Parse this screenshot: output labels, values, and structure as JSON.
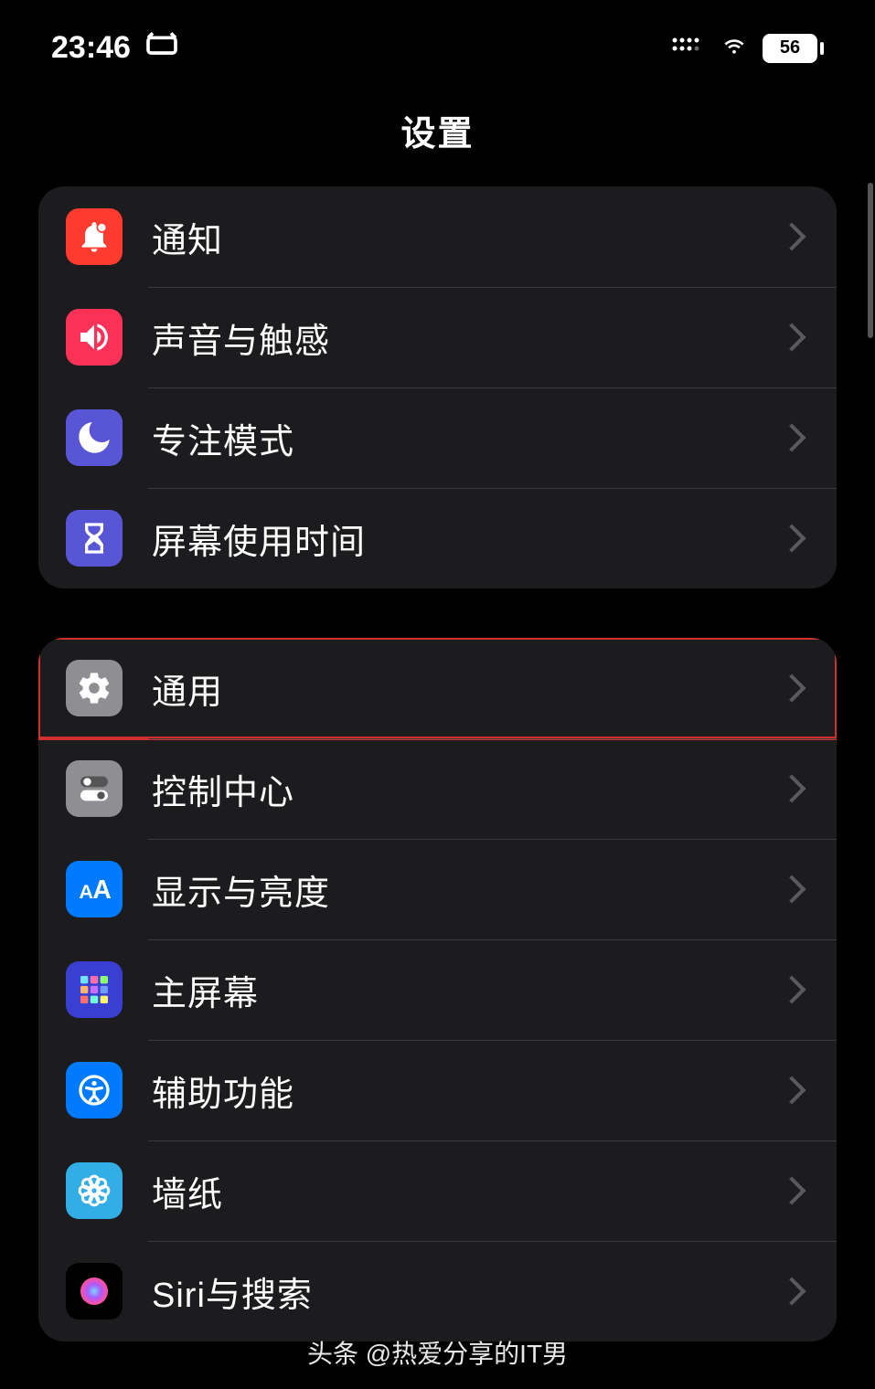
{
  "status": {
    "time": "23:46",
    "battery_text": "56"
  },
  "title": "设置",
  "group1": {
    "items": [
      {
        "label": "通知"
      },
      {
        "label": "声音与触感"
      },
      {
        "label": "专注模式"
      },
      {
        "label": "屏幕使用时间"
      }
    ]
  },
  "group2": {
    "items": [
      {
        "label": "通用"
      },
      {
        "label": "控制中心"
      },
      {
        "label": "显示与亮度"
      },
      {
        "label": "主屏幕"
      },
      {
        "label": "辅助功能"
      },
      {
        "label": "墙纸"
      },
      {
        "label": "Siri与搜索"
      }
    ]
  },
  "footer": {
    "attribution_prefix": "头条",
    "attribution_handle": "@热爱分享的IT男"
  }
}
